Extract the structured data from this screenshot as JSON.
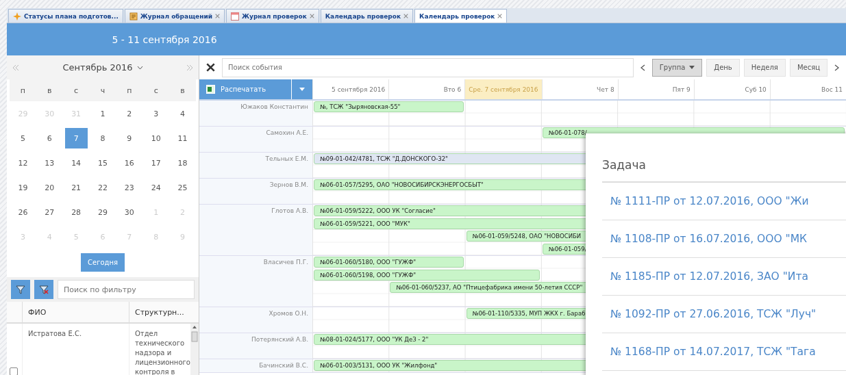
{
  "tabs": [
    {
      "label": "Статусы плана подготов...",
      "closable": false,
      "selected": false
    },
    {
      "label": "Журнал обращений",
      "closable": true,
      "selected": false
    },
    {
      "label": "Журнал проверок",
      "closable": true,
      "selected": false
    },
    {
      "label": "Календарь проверок",
      "closable": true,
      "selected": false
    },
    {
      "label": "Календарь проверок",
      "closable": true,
      "selected": true
    }
  ],
  "header": {
    "title": "5 - 11 сентября 2016"
  },
  "mini_calendar": {
    "month": "Сентябрь 2016",
    "weekdays": [
      "п",
      "в",
      "с",
      "ч",
      "п",
      "с",
      "в"
    ],
    "days": [
      {
        "label": "29",
        "muted": true,
        "selected": false
      },
      {
        "label": "30",
        "muted": true,
        "selected": false
      },
      {
        "label": "31",
        "muted": true,
        "selected": false
      },
      {
        "label": "1",
        "muted": false,
        "selected": false
      },
      {
        "label": "2",
        "muted": false,
        "selected": false
      },
      {
        "label": "3",
        "muted": false,
        "selected": false
      },
      {
        "label": "4",
        "muted": false,
        "selected": false
      },
      {
        "label": "5",
        "muted": false,
        "selected": false
      },
      {
        "label": "6",
        "muted": false,
        "selected": false
      },
      {
        "label": "7",
        "muted": false,
        "selected": true
      },
      {
        "label": "8",
        "muted": false,
        "selected": false
      },
      {
        "label": "9",
        "muted": false,
        "selected": false
      },
      {
        "label": "10",
        "muted": false,
        "selected": false
      },
      {
        "label": "11",
        "muted": false,
        "selected": false
      },
      {
        "label": "12",
        "muted": false,
        "selected": false
      },
      {
        "label": "13",
        "muted": false,
        "selected": false
      },
      {
        "label": "14",
        "muted": false,
        "selected": false
      },
      {
        "label": "15",
        "muted": false,
        "selected": false
      },
      {
        "label": "16",
        "muted": false,
        "selected": false
      },
      {
        "label": "17",
        "muted": false,
        "selected": false
      },
      {
        "label": "18",
        "muted": false,
        "selected": false
      },
      {
        "label": "19",
        "muted": false,
        "selected": false
      },
      {
        "label": "20",
        "muted": false,
        "selected": false
      },
      {
        "label": "21",
        "muted": false,
        "selected": false
      },
      {
        "label": "22",
        "muted": false,
        "selected": false
      },
      {
        "label": "23",
        "muted": false,
        "selected": false
      },
      {
        "label": "24",
        "muted": false,
        "selected": false
      },
      {
        "label": "25",
        "muted": false,
        "selected": false
      },
      {
        "label": "26",
        "muted": false,
        "selected": false
      },
      {
        "label": "27",
        "muted": false,
        "selected": false
      },
      {
        "label": "28",
        "muted": false,
        "selected": false
      },
      {
        "label": "29",
        "muted": false,
        "selected": false
      },
      {
        "label": "30",
        "muted": false,
        "selected": false
      },
      {
        "label": "1",
        "muted": true,
        "selected": false
      },
      {
        "label": "2",
        "muted": true,
        "selected": false
      },
      {
        "label": "3",
        "muted": true,
        "selected": false
      },
      {
        "label": "4",
        "muted": true,
        "selected": false
      },
      {
        "label": "5",
        "muted": true,
        "selected": false
      },
      {
        "label": "6",
        "muted": true,
        "selected": false
      },
      {
        "label": "7",
        "muted": true,
        "selected": false
      },
      {
        "label": "8",
        "muted": true,
        "selected": false
      },
      {
        "label": "9",
        "muted": true,
        "selected": false
      }
    ],
    "today_button": "Сегодня"
  },
  "filter": {
    "placeholder": "Поиск по фильтру"
  },
  "staff_table": {
    "columns": [
      "ФИО",
      "Структурн..."
    ],
    "rows": [
      {
        "checked": false,
        "name": "Истратова Е.С.",
        "department": "Отдел технического надзора и лицензионного контроля в"
      }
    ]
  },
  "toolbar": {
    "search_placeholder": "Поиск события",
    "views": [
      {
        "label": "Группа",
        "dropdown": true,
        "selected": true
      },
      {
        "label": "День",
        "dropdown": false,
        "selected": false
      },
      {
        "label": "Неделя",
        "dropdown": false,
        "selected": false
      },
      {
        "label": "Месяц",
        "dropdown": false,
        "selected": false
      }
    ]
  },
  "print_button": "Распечатать",
  "days": [
    {
      "label": "5 сентября 2016",
      "today": false
    },
    {
      "label": "Вто 6",
      "today": false
    },
    {
      "label": "Сре. 7 сентября 2016",
      "today": true
    },
    {
      "label": "Чет 8",
      "today": false
    },
    {
      "label": "Пят 9",
      "today": false
    },
    {
      "label": "Суб 10",
      "today": false
    },
    {
      "label": "Вос 11",
      "today": false
    }
  ],
  "resources": [
    {
      "name": "Южаков Константин",
      "events": [
        {
          "text": "№, ТСЖ \"Зыряновская-55\"",
          "kind": "open"
        }
      ]
    },
    {
      "name": "Самохин А.Е.",
      "events": [
        {
          "text": "№06-01-078/",
          "kind": "open"
        }
      ]
    },
    {
      "name": "Тельных Е.М.",
      "events": [
        {
          "text": "№09-01-042/4781, ТСЖ \"Д.ДОНСКОГО-32\"",
          "kind": "done"
        }
      ]
    },
    {
      "name": "Зернов В.М.",
      "events": [
        {
          "text": "№06-01-057/5295, ОАО \"НОВОСИБИРСКЭНЕРГОСБЫТ\"",
          "kind": "open"
        }
      ]
    },
    {
      "name": "Глотов А.В.",
      "events": [
        {
          "text": "№06-01-059/5222, ООО УК \"Согласие\"",
          "kind": "open"
        },
        {
          "text": "№06-01-059/5221, ООО \"МУК\"",
          "kind": "open"
        },
        {
          "text": "№06-01-059/5248, ОАО \"НОВОСИБИ",
          "kind": "open"
        },
        {
          "text": "№06-01-059/",
          "kind": "open"
        }
      ]
    },
    {
      "name": "Власичев П.Г.",
      "events": [
        {
          "text": "№06-01-060/5180, ООО \"ГУЖФ\"",
          "kind": "open"
        },
        {
          "text": "№06-01-060/5198, ООО \"ГУЖФ\"",
          "kind": "open"
        },
        {
          "text": "№06-01-060/5237, АО \"Птицефабрика имени 50-летия СССР\"",
          "kind": "open"
        }
      ]
    },
    {
      "name": "Хромов О.Н.",
      "events": [
        {
          "text": "№06-01-110/5335, МУП ЖКХ г. Бараб",
          "kind": "open"
        }
      ]
    },
    {
      "name": "Потерянский А.В.",
      "events": [
        {
          "text": "№08-01-024/5177, ООО \"УК ДеЗ - 2\"",
          "kind": "open"
        }
      ]
    },
    {
      "name": "Бачинский В.С.",
      "events": [
        {
          "text": "№06-01-003/5131, ООО УК \"Жилфонд\"",
          "kind": "open"
        }
      ]
    }
  ],
  "task_popup": {
    "title": "Задача",
    "items": [
      "№ 1111-ПР от 12.07.2016, ООО \"Жи",
      "№ 1108-ПР от 16.07.2016, ООО \"МК",
      "№ 1185-ПР от 12.07.2016, ЗАО \"Ита",
      "№ 1092-ПР от 27.06.2016, ТСЖ \"Луч\"",
      "№ 1168-ПР от 14.07.2017, ТСЖ \"Тага"
    ]
  }
}
